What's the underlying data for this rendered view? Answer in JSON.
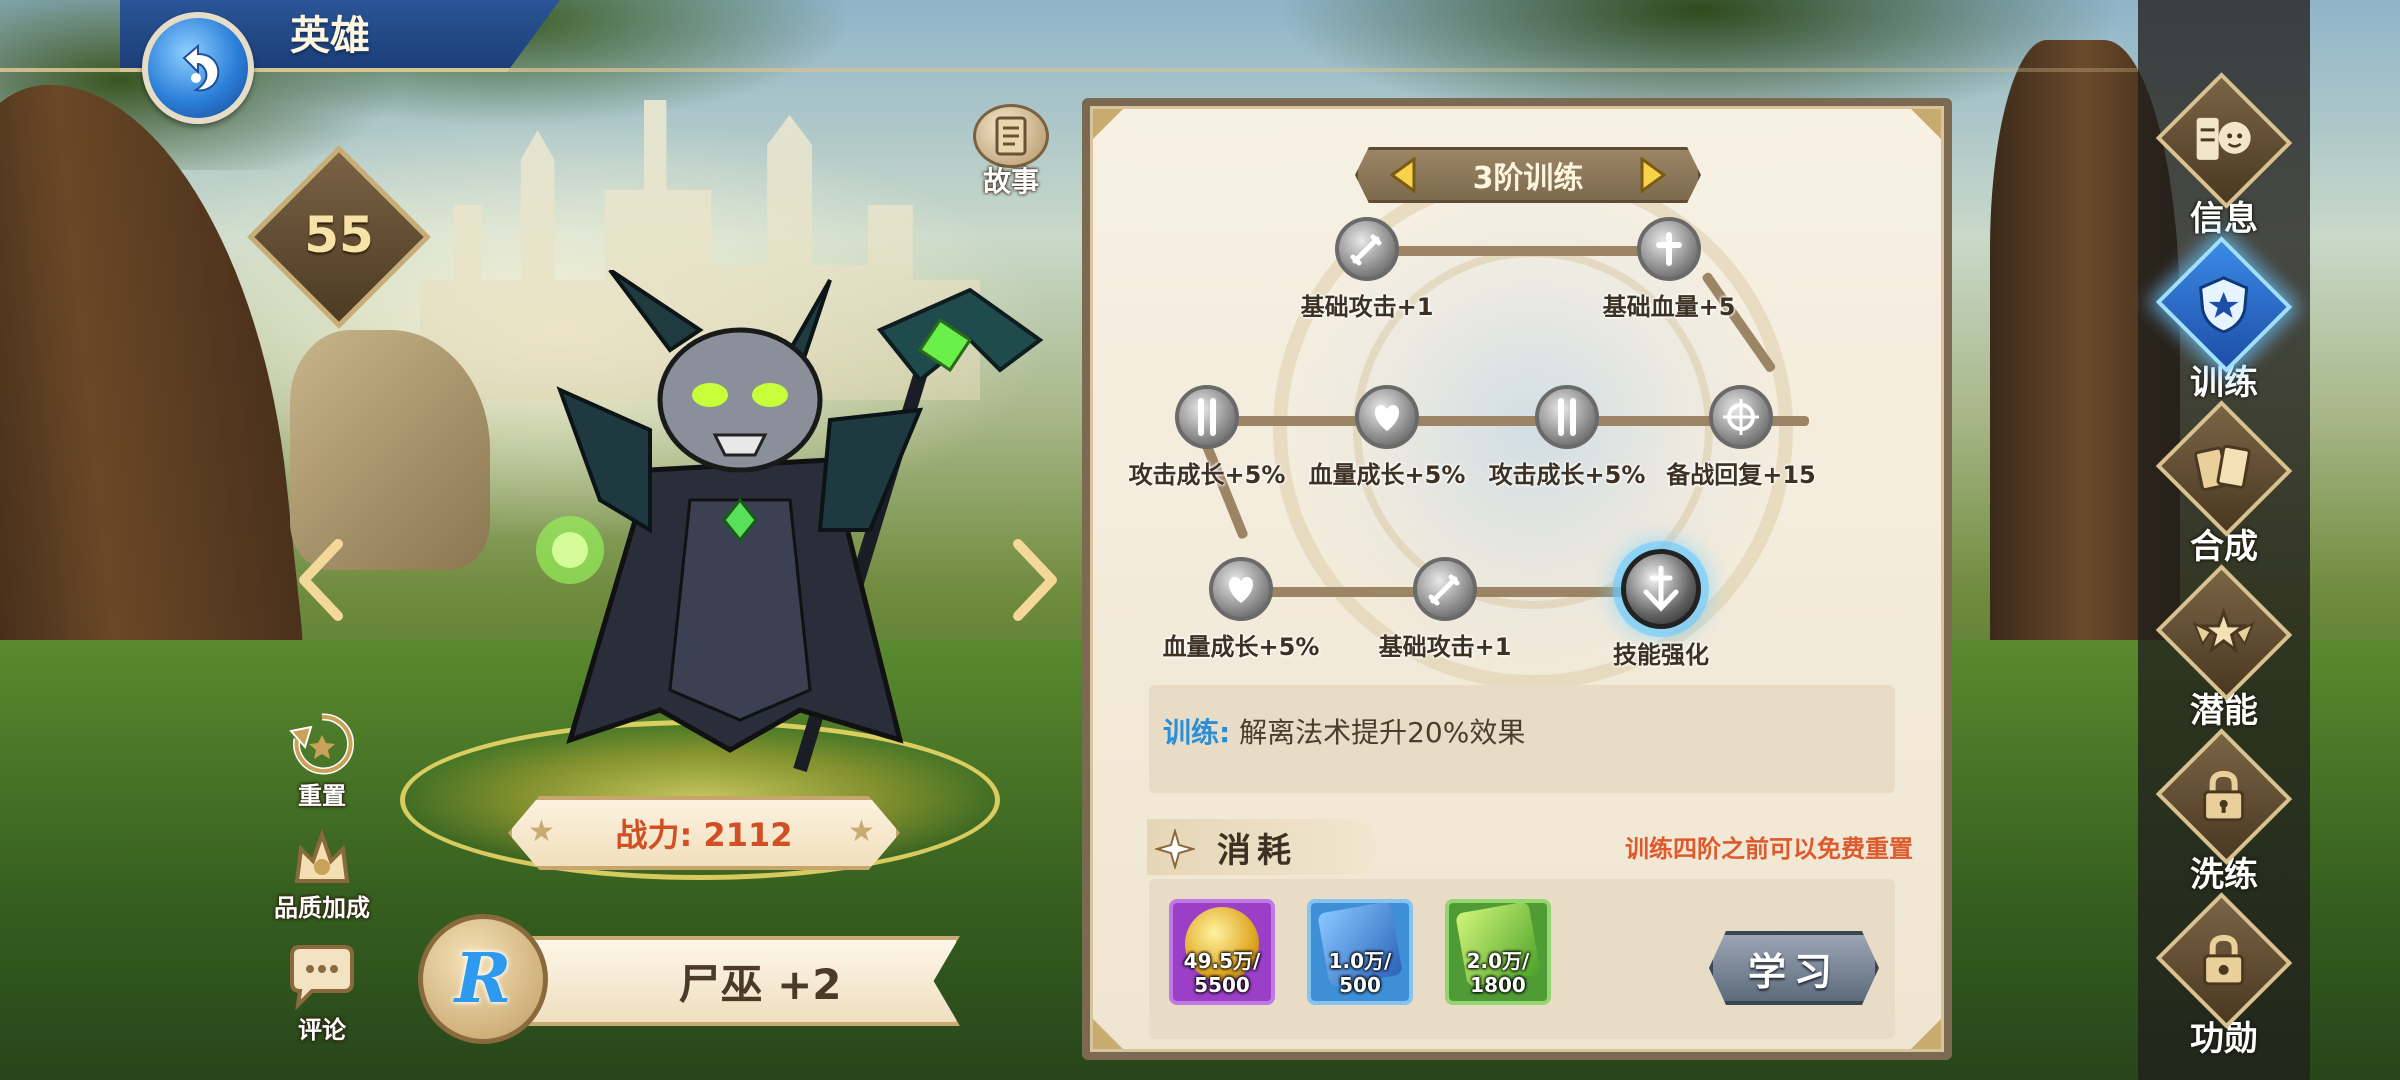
{
  "header": {
    "title": "英雄"
  },
  "hero": {
    "level": "55",
    "story_label": "故事",
    "power_text": "战力: 2112",
    "name": "尸巫 +2",
    "rarity": "R"
  },
  "left_actions": {
    "reset_label": "重置",
    "quality_label": "品质加成",
    "comment_label": "评论"
  },
  "training": {
    "tier_title": "3阶训练",
    "nodes": [
      {
        "label": "基础攻击+1",
        "icon": "sword-icon"
      },
      {
        "label": "基础血量+5",
        "icon": "cross-icon"
      },
      {
        "label": "攻击成长+5%",
        "icon": "double-sword-icon"
      },
      {
        "label": "血量成长+5%",
        "icon": "heart-plus-icon"
      },
      {
        "label": "攻击成长+5%",
        "icon": "double-sword-icon"
      },
      {
        "label": "备战回复+15",
        "icon": "crosshair-icon"
      },
      {
        "label": "血量成长+5%",
        "icon": "heart-plus-icon"
      },
      {
        "label": "基础攻击+1",
        "icon": "sword-icon"
      },
      {
        "label": "技能强化",
        "icon": "skill-sword-icon"
      }
    ],
    "desc_label": "训练:",
    "desc_text": "解离法术提升20%效果",
    "cost_title": "消耗",
    "cost_hint": "训练四阶之前可以免费重置",
    "costs": [
      {
        "qty": "49.5万/\n5500",
        "icon": "gold-coin-icon",
        "color": "#9b3fc7"
      },
      {
        "qty": "1.0万/\n500",
        "icon": "blue-book-icon",
        "color": "#3f8fd6"
      },
      {
        "qty": "2.0万/\n1800",
        "icon": "green-book-icon",
        "color": "#4f9c36"
      }
    ],
    "learn_label": "学习"
  },
  "right_menu": [
    {
      "label": "信息",
      "icon": "info-face-icon",
      "active": false
    },
    {
      "label": "训练",
      "icon": "training-shield-icon",
      "active": true
    },
    {
      "label": "合成",
      "icon": "cards-icon",
      "active": false
    },
    {
      "label": "潜能",
      "icon": "star-wings-icon",
      "active": false
    },
    {
      "label": "洗练",
      "icon": "lock-icon",
      "active": false
    },
    {
      "label": "功勋",
      "icon": "medal-lock-icon",
      "active": false
    }
  ],
  "colors": {
    "accent_blue": "#2b8fd6",
    "power_red": "#d24f24",
    "hint_orange": "#de5a2c",
    "panel_bg": "#f7f1e4"
  }
}
